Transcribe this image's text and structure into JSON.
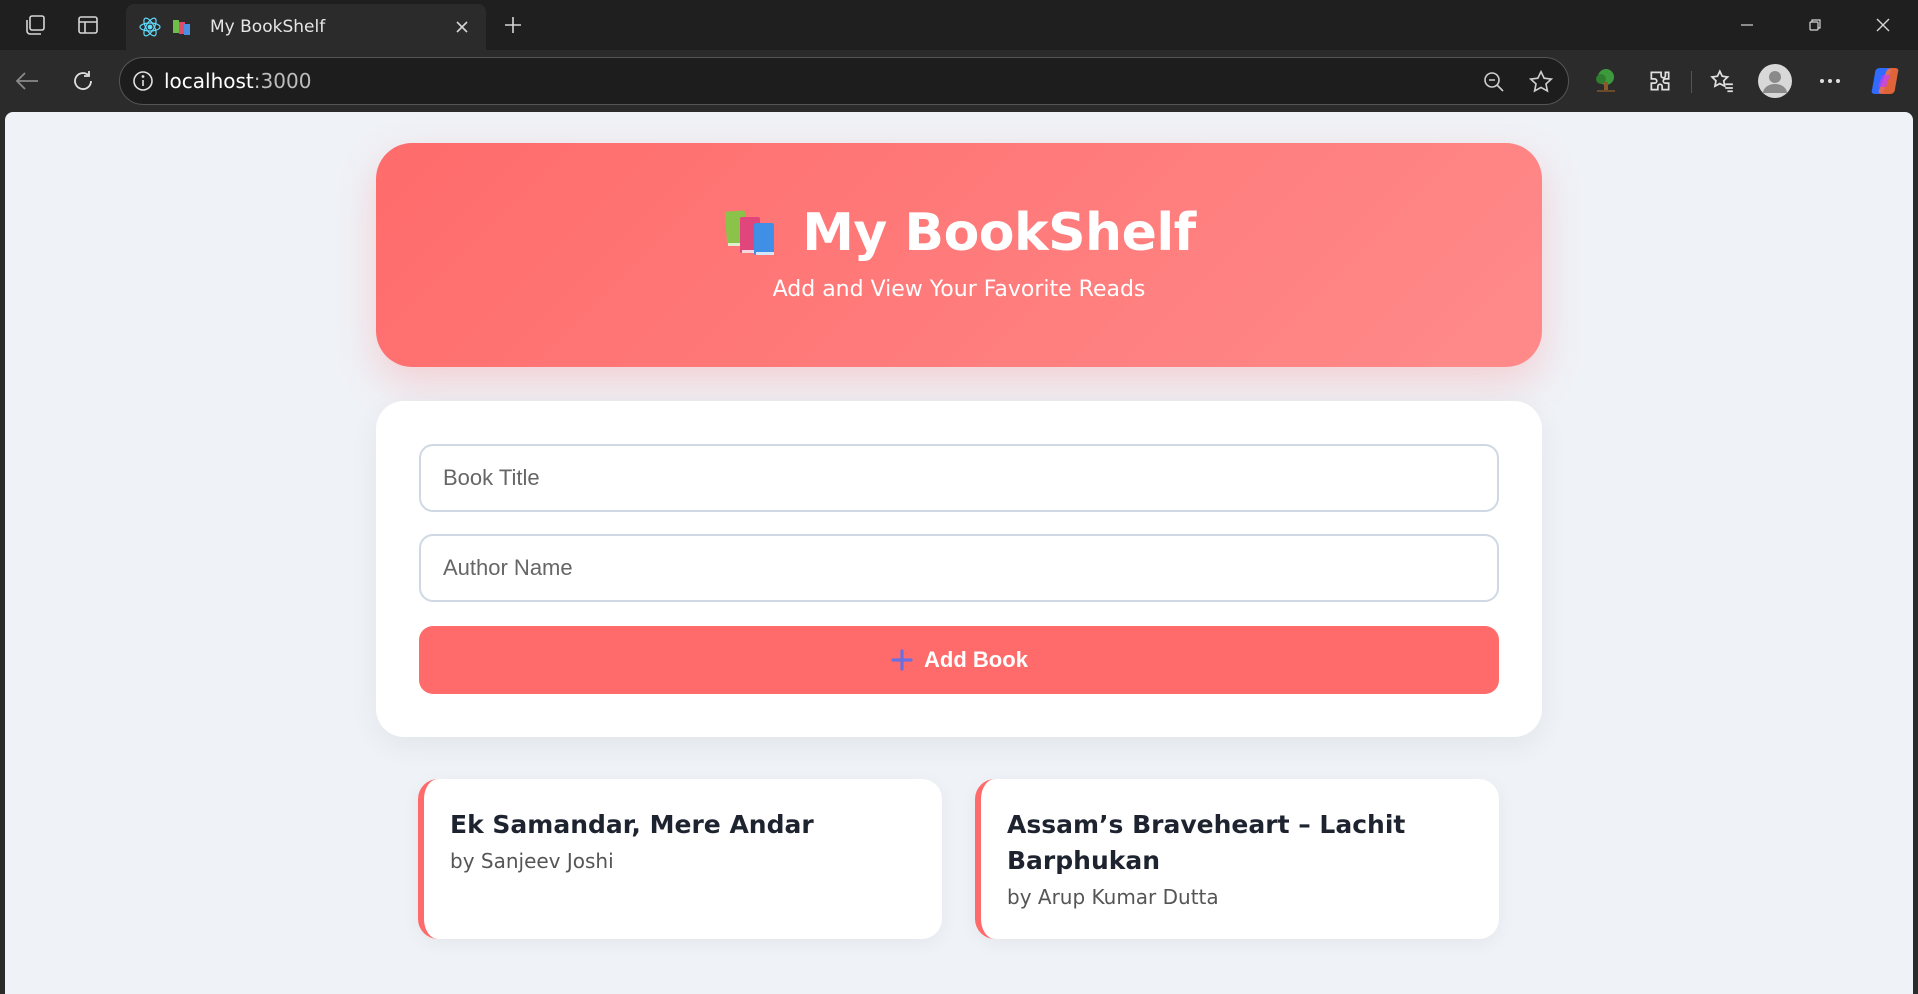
{
  "browser": {
    "tab": {
      "title": "My BookShelf"
    },
    "address": {
      "host": "localhost",
      "port": ":3000"
    }
  },
  "header": {
    "title": "My BookShelf",
    "subtitle": "Add and View Your Favorite Reads"
  },
  "form": {
    "title_placeholder": "Book Title",
    "author_placeholder": "Author Name",
    "title_value": "",
    "author_value": "",
    "submit_label": "Add Book"
  },
  "books": [
    {
      "title": "Ek Samandar, Mere Andar",
      "author": "by Sanjeev Joshi"
    },
    {
      "title": "Assam’s Braveheart – Lachit Barphukan",
      "author": "by Arup Kumar Dutta"
    }
  ],
  "colors": {
    "accent": "#ff6b6b",
    "page_background": "#eff2f7",
    "card_background": "#ffffff"
  }
}
